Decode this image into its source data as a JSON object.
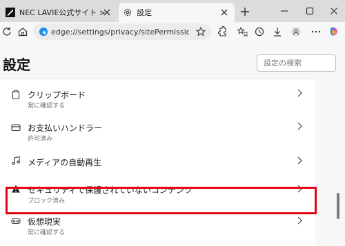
{
  "browser": {
    "tabs": [
      {
        "title": "NEC LAVIE公式サイト > サービス＆サ",
        "favicon": "nec-logo-icon",
        "active": false
      },
      {
        "title": "設定",
        "favicon": "gear-icon",
        "active": true
      }
    ],
    "address_bar": {
      "url": "edge://settings/privacy/sitePermissions/allP..."
    }
  },
  "settings": {
    "title": "設定",
    "search_placeholder": "設定の検索",
    "items": [
      {
        "title": "クリップボード",
        "subtitle": "常に確認する",
        "icon": "clipboard-icon"
      },
      {
        "title": "お支払いハンドラー",
        "subtitle": "許可済み",
        "icon": "credit-card-icon"
      },
      {
        "title": "メディアの自動再生",
        "subtitle": "",
        "icon": "music-note-icon",
        "highlighted": true
      },
      {
        "title": "セキュリティで保護されていないコンテンツ",
        "subtitle": "ブロック済み",
        "icon": "warning-icon"
      },
      {
        "title": "仮想現実",
        "subtitle": "常に確認する",
        "icon": "vr-headset-icon"
      }
    ]
  },
  "colors": {
    "highlight": "#e60012",
    "accent": "#0078d4"
  }
}
